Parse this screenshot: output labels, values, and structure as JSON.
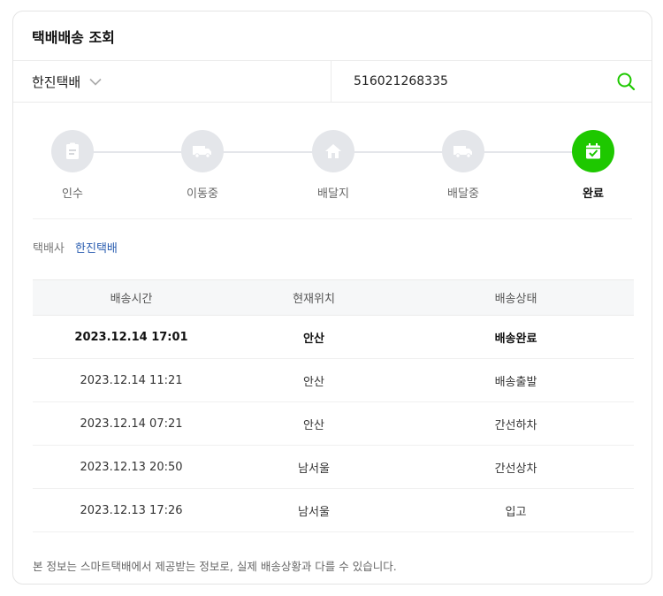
{
  "header": {
    "title": "택배배송 조회"
  },
  "search": {
    "carrier": "한진택배",
    "tracking_number": "516021268335"
  },
  "steps": [
    {
      "label": "인수",
      "icon": "receipt-icon",
      "active": false
    },
    {
      "label": "이동중",
      "icon": "truck-icon",
      "active": false
    },
    {
      "label": "배달지",
      "icon": "house-icon",
      "active": false
    },
    {
      "label": "배달중",
      "icon": "truck-icon",
      "active": false
    },
    {
      "label": "완료",
      "icon": "calendar-check-icon",
      "active": true
    }
  ],
  "company": {
    "label": "택배사",
    "value": "한진택배"
  },
  "table": {
    "headers": [
      "배송시간",
      "현재위치",
      "배송상태"
    ],
    "rows": [
      [
        "2023.12.14 17:01",
        "안산",
        "배송완료"
      ],
      [
        "2023.12.14 11:21",
        "안산",
        "배송출발"
      ],
      [
        "2023.12.14 07:21",
        "안산",
        "간선하차"
      ],
      [
        "2023.12.13 20:50",
        "남서울",
        "간선상차"
      ],
      [
        "2023.12.13 17:26",
        "남서울",
        "입고"
      ]
    ]
  },
  "notice": "본 정보는 스마트택배에서 제공받는 정보로, 실제 배송상황과 다를 수 있습니다.",
  "colors": {
    "accent": "#1ec800",
    "inactive": "#e4e6ea",
    "link": "#2a5db0"
  }
}
